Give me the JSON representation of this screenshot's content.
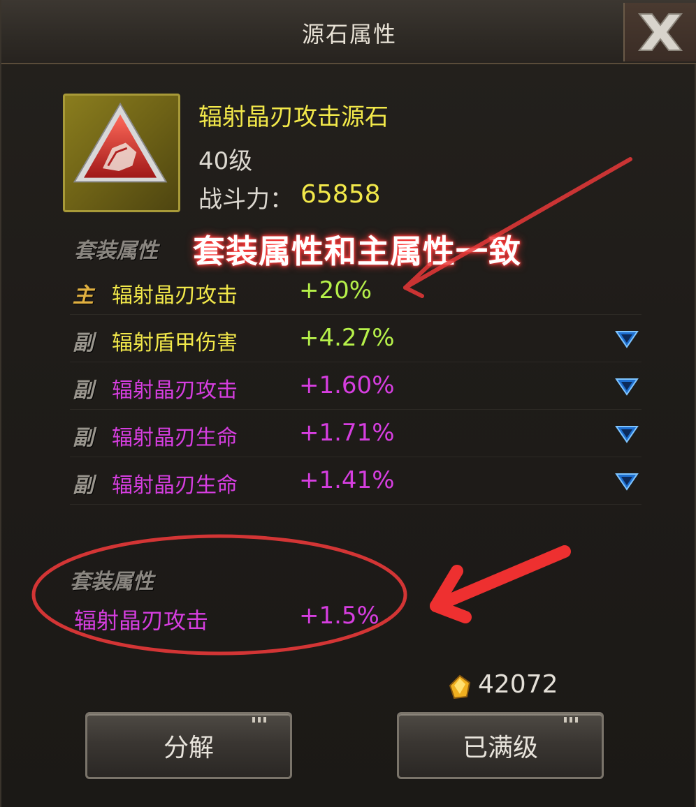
{
  "window": {
    "title": "源石属性",
    "close_icon": "close-x-icon"
  },
  "item": {
    "name": "辐射晶刃攻击源石",
    "level": "40级",
    "power_label": "战斗力：",
    "power_value": "65858",
    "icon": "red-triangle-stone-icon"
  },
  "set_heading": "套装属性",
  "annotation_top": "套装属性和主属性一致",
  "attributes": [
    {
      "tag": "主",
      "name": "辐射晶刃攻击",
      "value": "+20%",
      "name_color": "#f2e84a",
      "tag_color": "#e0b040",
      "has_arrow": false
    },
    {
      "tag": "副",
      "name": "辐射盾甲伤害",
      "value": "+4.27%",
      "name_color": "#f2e84a",
      "tag_color": "#9a968e",
      "has_arrow": true
    },
    {
      "tag": "副",
      "name": "辐射晶刃攻击",
      "value": "+1.60%",
      "name_color": "#d63ee0",
      "tag_color": "#9a968e",
      "has_arrow": true
    },
    {
      "tag": "副",
      "name": "辐射晶刃生命",
      "value": "+1.71%",
      "name_color": "#d63ee0",
      "tag_color": "#9a968e",
      "has_arrow": true
    },
    {
      "tag": "副",
      "name": "辐射晶刃生命",
      "value": "+1.41%",
      "name_color": "#d63ee0",
      "tag_color": "#9a968e",
      "has_arrow": true
    }
  ],
  "set_bonus": {
    "heading": "套装属性",
    "name": "辐射晶刃攻击",
    "value": "+1.5%"
  },
  "currency": {
    "value": "42072",
    "icon": "gold-crystal-icon"
  },
  "buttons": {
    "decompose": "分解",
    "maxed": "已满级"
  },
  "colors": {
    "value_green": "#b6f04a",
    "highlight_yellow": "#f2e84a",
    "purple": "#d63ee0",
    "annotation_red": "#ff3a3a"
  }
}
